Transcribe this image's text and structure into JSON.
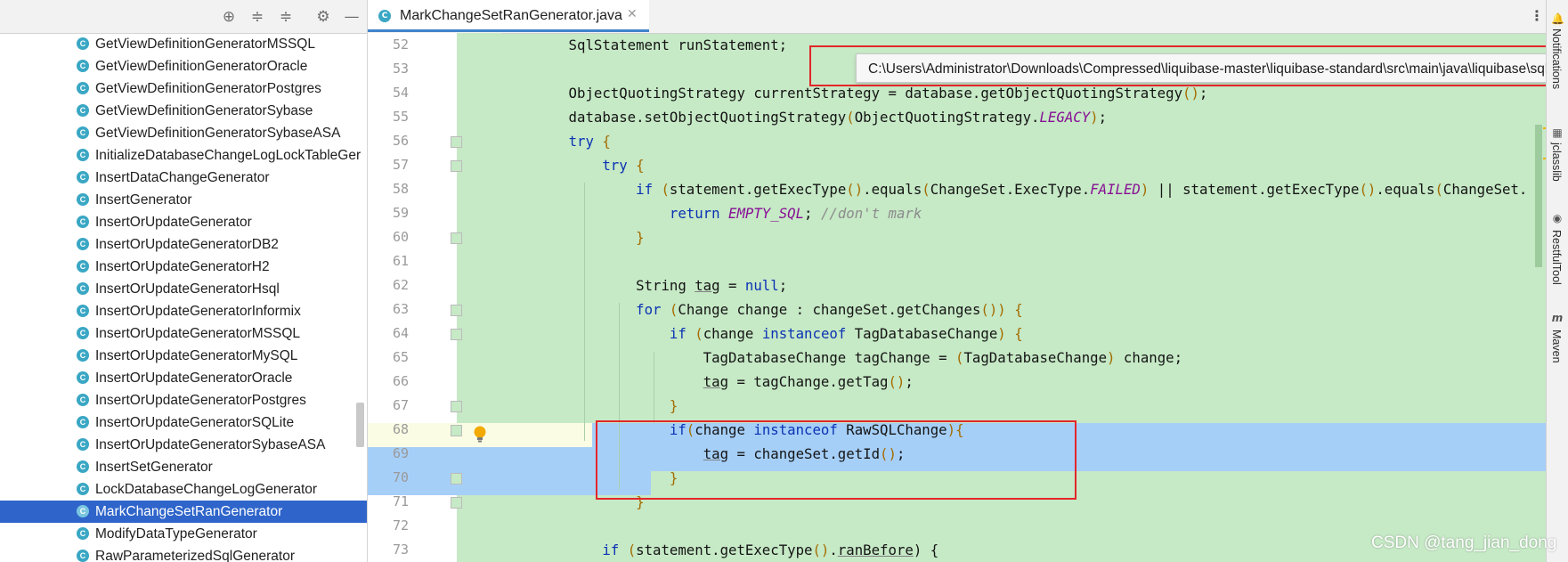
{
  "tree": {
    "toolbar_icons": [
      "locate-icon",
      "expand-all-icon",
      "collapse-all-icon",
      "gear-icon",
      "minimize-icon"
    ],
    "items": [
      {
        "label": "GetViewDefinitionGeneratorMSSQL",
        "selected": false
      },
      {
        "label": "GetViewDefinitionGeneratorOracle",
        "selected": false
      },
      {
        "label": "GetViewDefinitionGeneratorPostgres",
        "selected": false
      },
      {
        "label": "GetViewDefinitionGeneratorSybase",
        "selected": false
      },
      {
        "label": "GetViewDefinitionGeneratorSybaseASA",
        "selected": false
      },
      {
        "label": "InitializeDatabaseChangeLogLockTableGer",
        "selected": false
      },
      {
        "label": "InsertDataChangeGenerator",
        "selected": false
      },
      {
        "label": "InsertGenerator",
        "selected": false
      },
      {
        "label": "InsertOrUpdateGenerator",
        "selected": false
      },
      {
        "label": "InsertOrUpdateGeneratorDB2",
        "selected": false
      },
      {
        "label": "InsertOrUpdateGeneratorH2",
        "selected": false
      },
      {
        "label": "InsertOrUpdateGeneratorHsql",
        "selected": false
      },
      {
        "label": "InsertOrUpdateGeneratorInformix",
        "selected": false
      },
      {
        "label": "InsertOrUpdateGeneratorMSSQL",
        "selected": false
      },
      {
        "label": "InsertOrUpdateGeneratorMySQL",
        "selected": false
      },
      {
        "label": "InsertOrUpdateGeneratorOracle",
        "selected": false
      },
      {
        "label": "InsertOrUpdateGeneratorPostgres",
        "selected": false
      },
      {
        "label": "InsertOrUpdateGeneratorSQLite",
        "selected": false
      },
      {
        "label": "InsertOrUpdateGeneratorSybaseASA",
        "selected": false
      },
      {
        "label": "InsertSetGenerator",
        "selected": false
      },
      {
        "label": "LockDatabaseChangeLogGenerator",
        "selected": false
      },
      {
        "label": "MarkChangeSetRanGenerator",
        "selected": true
      },
      {
        "label": "ModifyDataTypeGenerator",
        "selected": false
      },
      {
        "label": "RawParameterizedSqlGenerator",
        "selected": false
      }
    ]
  },
  "editor": {
    "tab": {
      "label": "MarkChangeSetRanGenerator.java",
      "icon": "class-icon",
      "close": "✕"
    },
    "more_menu": "⋮",
    "tooltip_path": "C:\\Users\\Administrator\\Downloads\\Compressed\\liquibase-master\\liquibase-standard\\src\\main\\java\\liquibase\\sqlgenerator\\core\\MarkChangeSetRanGenerator.java",
    "lines": [
      {
        "n": "52",
        "segs": [
          [
            "",
            "        SqlStatement runStatement;"
          ]
        ]
      },
      {
        "n": "53",
        "segs": [
          [
            "",
            ""
          ]
        ]
      },
      {
        "n": "54",
        "segs": [
          [
            "",
            "        ObjectQuotingStrategy currentStrategy = database.getObjectQuotingStrategy"
          ],
          [
            "pm",
            "()"
          ],
          [
            "",
            ";"
          ]
        ]
      },
      {
        "n": "55",
        "segs": [
          [
            "",
            "        database.setObjectQuotingStrategy"
          ],
          [
            "pm",
            "("
          ],
          [
            "",
            "ObjectQuotingStrategy."
          ],
          [
            "cn",
            "LEGACY"
          ],
          [
            "pm",
            ")"
          ],
          [
            "",
            ";"
          ]
        ]
      },
      {
        "n": "56",
        "segs": [
          [
            "",
            "        "
          ],
          [
            "kw",
            "try"
          ],
          [
            "",
            " "
          ],
          [
            "pm",
            "{"
          ]
        ]
      },
      {
        "n": "57",
        "segs": [
          [
            "",
            "            "
          ],
          [
            "kw",
            "try"
          ],
          [
            "",
            " "
          ],
          [
            "pm",
            "{"
          ]
        ]
      },
      {
        "n": "58",
        "segs": [
          [
            "",
            "                "
          ],
          [
            "kw",
            "if"
          ],
          [
            "",
            " "
          ],
          [
            "pm",
            "("
          ],
          [
            "",
            "statement.getExecType"
          ],
          [
            "pm",
            "()"
          ],
          [
            "",
            ".equals"
          ],
          [
            "pm",
            "("
          ],
          [
            "",
            "ChangeSet.ExecType."
          ],
          [
            "cn",
            "FAILED"
          ],
          [
            "pm",
            ")"
          ],
          [
            "",
            " || statement.getExecType"
          ],
          [
            "pm",
            "()"
          ],
          [
            "",
            ".equals"
          ],
          [
            "pm",
            "("
          ],
          [
            "",
            "ChangeSet."
          ]
        ]
      },
      {
        "n": "59",
        "segs": [
          [
            "",
            "                    "
          ],
          [
            "kw",
            "return"
          ],
          [
            "",
            " "
          ],
          [
            "cn",
            "EMPTY_SQL"
          ],
          [
            "",
            "; "
          ],
          [
            "cm",
            "//don't mark"
          ]
        ]
      },
      {
        "n": "60",
        "segs": [
          [
            "",
            "                "
          ],
          [
            "pm",
            "}"
          ]
        ]
      },
      {
        "n": "61",
        "segs": [
          [
            "",
            ""
          ]
        ]
      },
      {
        "n": "62",
        "segs": [
          [
            "",
            "                String "
          ],
          [
            "ul",
            "tag"
          ],
          [
            "",
            " = "
          ],
          [
            "kw",
            "null"
          ],
          [
            "",
            ";"
          ]
        ]
      },
      {
        "n": "63",
        "segs": [
          [
            "",
            "                "
          ],
          [
            "kw",
            "for"
          ],
          [
            "",
            " "
          ],
          [
            "pm",
            "("
          ],
          [
            "",
            "Change change : changeSet.getChanges"
          ],
          [
            "pm",
            "())"
          ],
          [
            "",
            " "
          ],
          [
            "pm",
            "{"
          ]
        ]
      },
      {
        "n": "64",
        "segs": [
          [
            "",
            "                    "
          ],
          [
            "kw",
            "if"
          ],
          [
            "",
            " "
          ],
          [
            "pm",
            "("
          ],
          [
            "",
            "change "
          ],
          [
            "kw",
            "instanceof"
          ],
          [
            "",
            " TagDatabaseChange"
          ],
          [
            "pm",
            ")"
          ],
          [
            "",
            " "
          ],
          [
            "pm",
            "{"
          ]
        ]
      },
      {
        "n": "65",
        "segs": [
          [
            "",
            "                        TagDatabaseChange tagChange = "
          ],
          [
            "pm",
            "("
          ],
          [
            "",
            "TagDatabaseChange"
          ],
          [
            "pm",
            ")"
          ],
          [
            "",
            " change;"
          ]
        ]
      },
      {
        "n": "66",
        "segs": [
          [
            "",
            "                        "
          ],
          [
            "ul",
            "tag"
          ],
          [
            "",
            " = tagChange.getTag"
          ],
          [
            "pm",
            "()"
          ],
          [
            "",
            ";"
          ]
        ]
      },
      {
        "n": "67",
        "segs": [
          [
            "",
            "                    "
          ],
          [
            "pm",
            "}"
          ]
        ]
      },
      {
        "n": "68",
        "segs": [
          [
            "",
            "                    "
          ],
          [
            "kw",
            "if"
          ],
          [
            "pm",
            "("
          ],
          [
            "",
            "change "
          ],
          [
            "kw",
            "instanceof"
          ],
          [
            "",
            " RawSQLChange"
          ],
          [
            "pm",
            ")"
          ],
          [
            "pm",
            "{"
          ]
        ]
      },
      {
        "n": "69",
        "segs": [
          [
            "",
            "                        "
          ],
          [
            "ul",
            "tag"
          ],
          [
            "",
            " = changeSet.getId"
          ],
          [
            "pm",
            "()"
          ],
          [
            "",
            ";"
          ]
        ]
      },
      {
        "n": "70",
        "segs": [
          [
            "",
            "                    "
          ],
          [
            "pm",
            "}"
          ]
        ]
      },
      {
        "n": "71",
        "segs": [
          [
            "",
            "                "
          ],
          [
            "pm",
            "}"
          ]
        ]
      },
      {
        "n": "72",
        "segs": [
          [
            "",
            ""
          ]
        ]
      },
      {
        "n": "73",
        "segs": [
          [
            "",
            "            "
          ],
          [
            "kw",
            "if"
          ],
          [
            "",
            " "
          ],
          [
            "pm",
            "("
          ],
          [
            "",
            "statement.getExecType"
          ],
          [
            "pm",
            "()"
          ],
          [
            "",
            "."
          ],
          [
            "ul",
            "ranBefore"
          ],
          [
            "",
            ") {"
          ]
        ]
      }
    ]
  },
  "right_strip": {
    "tools": [
      {
        "label": "Notifications",
        "icon": "bell-icon"
      },
      {
        "label": "jclasslib",
        "icon": "jclasslib-icon"
      },
      {
        "label": "RestfulTool",
        "icon": "globe-icon"
      },
      {
        "label": "Maven",
        "icon": "maven-icon"
      }
    ]
  },
  "colors": {
    "editor_bg": "#c6e9c6",
    "selection": "#a6cff8",
    "highlight_box": "#e3262a",
    "tree_selected": "#2f65ca"
  },
  "watermark": "CSDN @tang_jian_dong"
}
